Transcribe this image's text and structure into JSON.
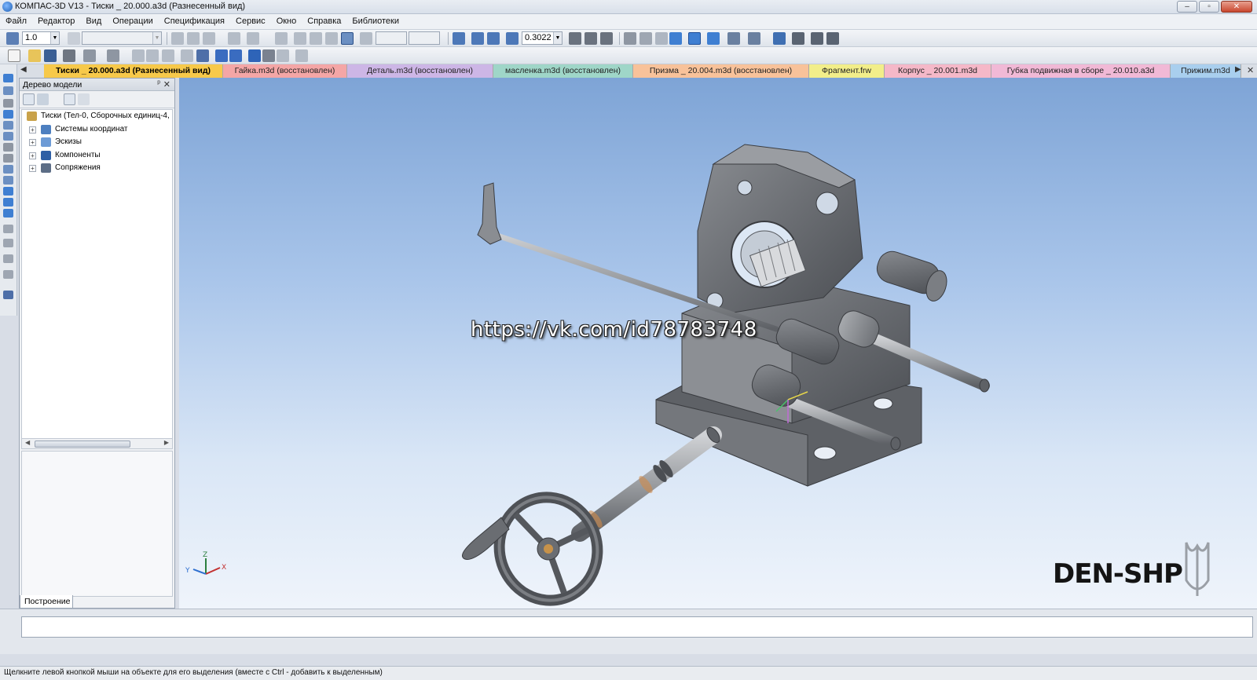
{
  "window": {
    "title": "КОМПАС-3D V13 - Тиски _ 20.000.a3d (Разнесенный вид)",
    "buttons": [
      "–",
      "▫",
      "✕"
    ]
  },
  "menu": [
    "Файл",
    "Редактор",
    "Вид",
    "Операции",
    "Спецификация",
    "Сервис",
    "Окно",
    "Справка",
    "Библиотеки"
  ],
  "toolbar": {
    "step_value": "1.0",
    "zoom_value": "0.3022"
  },
  "tabs": [
    {
      "label": "Тиски _ 20.000.a3d (Разнесенный вид)",
      "color": "#f7c94a",
      "active": true
    },
    {
      "label": "Гайка.m3d (восстановлен)",
      "color": "#f4a6a6"
    },
    {
      "label": "Деталь.m3d (восстановлен)",
      "color": "#cdb6e6"
    },
    {
      "label": "масленка.m3d (восстановлен)",
      "color": "#9fd6c8"
    },
    {
      "label": "Призма _ 20.004.m3d (восстановлен)",
      "color": "#f8c29a"
    },
    {
      "label": "Фрагмент.frw",
      "color": "#f2ee8a"
    },
    {
      "label": "Корпус _ 20.001.m3d",
      "color": "#f5b8c8"
    },
    {
      "label": "Губка подвижная в сборе _ 20.010.a3d",
      "color": "#f1b9d6"
    },
    {
      "label": "Прижим.m3d",
      "color": "#a9cfee"
    }
  ],
  "model_tree": {
    "header": "Дерево модели",
    "root": "Тиски (Тел-0, Сборочных единиц-4,",
    "items": [
      "Системы координат",
      "Эскизы",
      "Компоненты",
      "Сопряжения"
    ],
    "bottom_tab": "Построение"
  },
  "viewport": {
    "watermark": "https://vk.com/id78783748",
    "logo": "DEN-SHP",
    "axes": {
      "x": "X",
      "y": "Y",
      "z": "Z"
    }
  },
  "status_text": "Щелкните левой кнопкой мыши на объекте для его выделения (вместе с Ctrl - добавить к выделенным)"
}
